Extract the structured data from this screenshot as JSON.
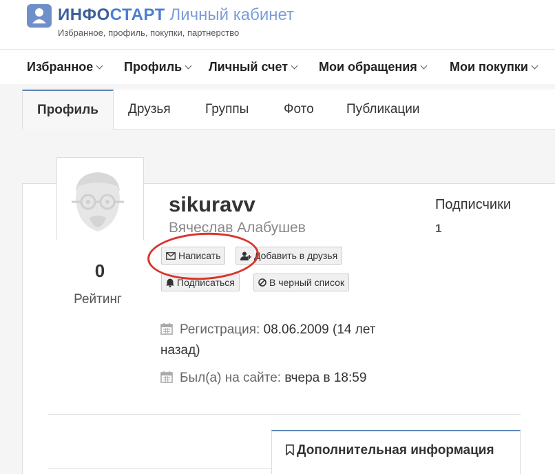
{
  "header": {
    "brand_bold_1": "ИНФО",
    "brand_bold_2": "СТАРТ",
    "brand_light": "Личный кабинет",
    "tagline": "Избранное, профиль, покупки, партнерство",
    "logo_icon": "user-icon",
    "accent_color": "#3c5e9e"
  },
  "nav": {
    "items": [
      {
        "label": "Избранное"
      },
      {
        "label": "Профиль"
      },
      {
        "label": "Личный счет"
      },
      {
        "label": "Мои обращения"
      },
      {
        "label": "Мои покупки"
      }
    ]
  },
  "tabs": [
    {
      "label": "Профиль",
      "active": true
    },
    {
      "label": "Друзья"
    },
    {
      "label": "Группы"
    },
    {
      "label": "Фото"
    },
    {
      "label": "Публикации"
    }
  ],
  "profile": {
    "username": "sikuravv",
    "full_name": "Вячеслав Алабушев",
    "rating_value": "0",
    "rating_label": "Рейтинг",
    "subscribers_label": "Подписчики",
    "subscribers_count": "1",
    "registration_label": "Регистрация:",
    "registration_value": "08.06.2009 (14 лет",
    "registration_value_2": "назад)",
    "last_seen_label": "Был(а) на сайте:",
    "last_seen_value": "вчера в 18:59"
  },
  "actions": {
    "write": "Написать",
    "add_friend": "Добавить в друзья",
    "subscribe": "Подписаться",
    "blacklist": "В черный список"
  },
  "more_info_tab": "Дополнительная информация",
  "highlight_color": "#d9342b"
}
